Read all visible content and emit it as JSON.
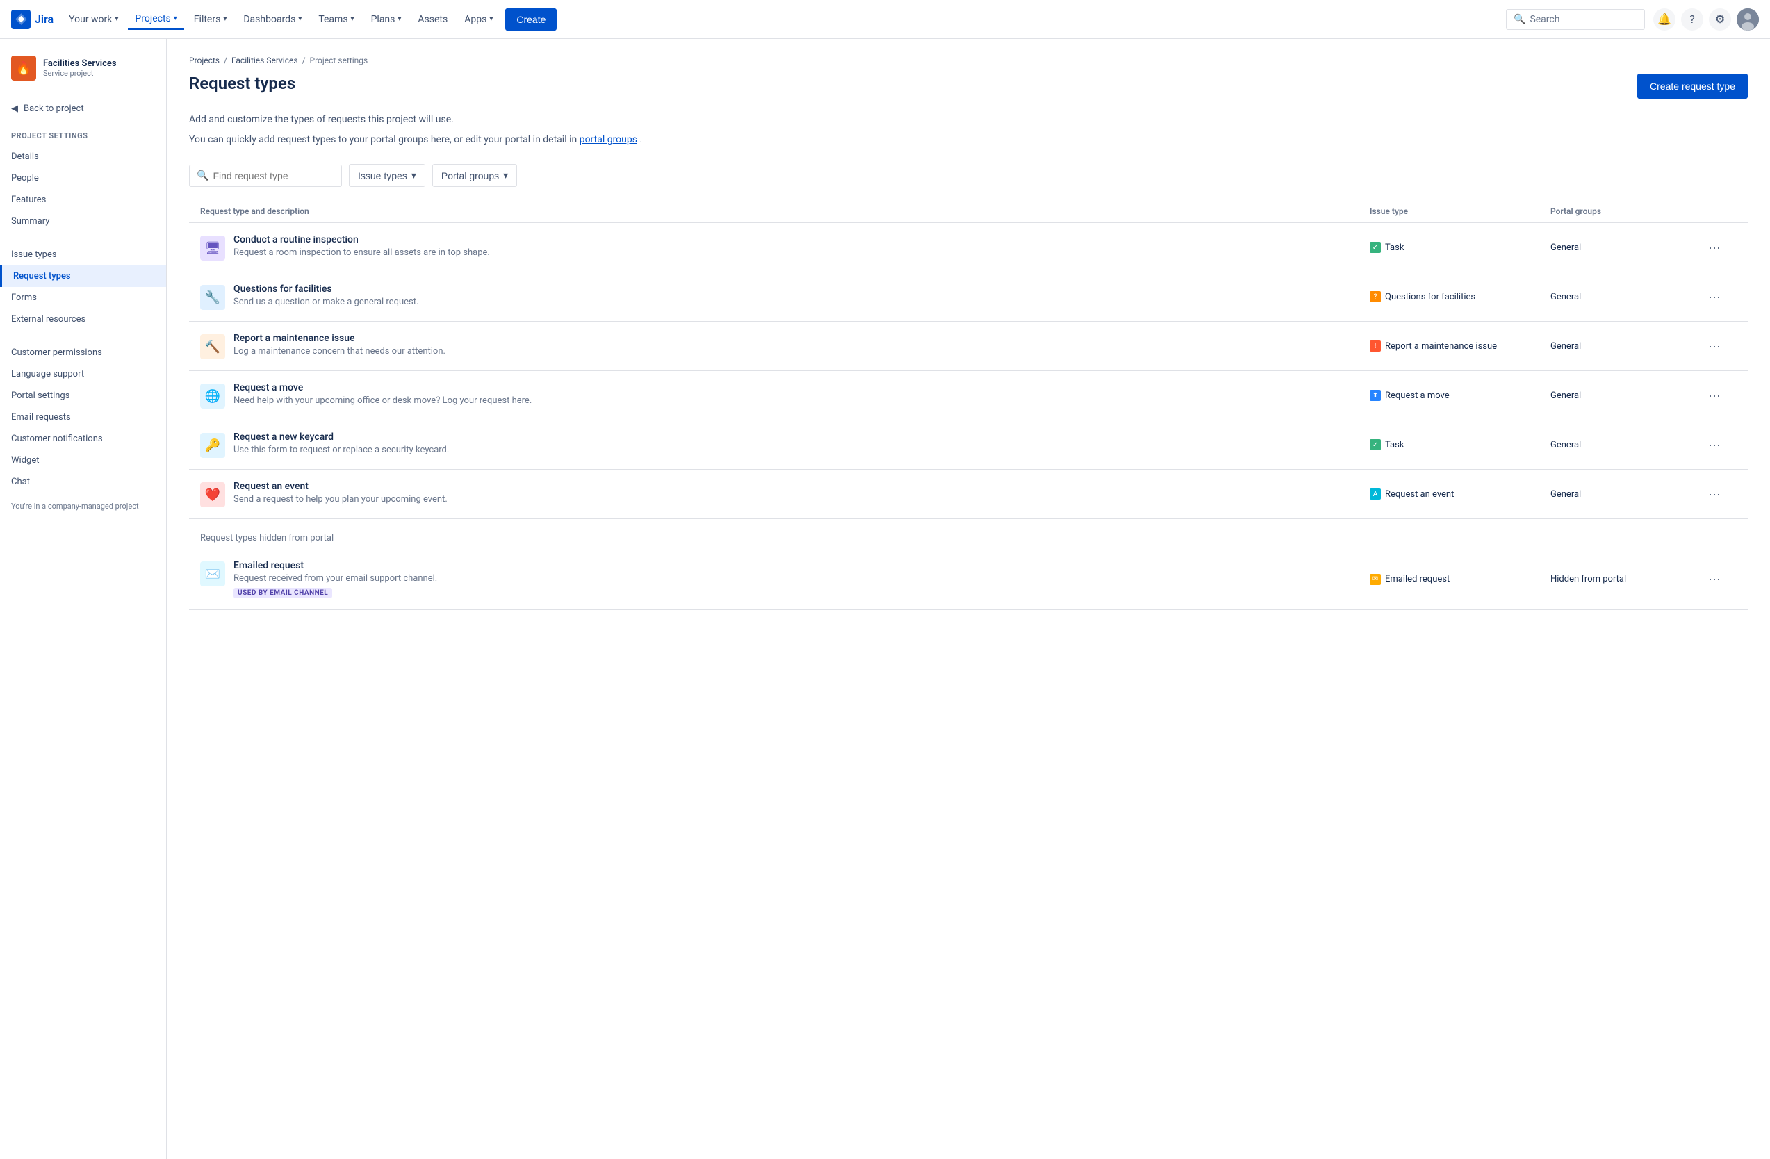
{
  "nav": {
    "logo_text": "Jira",
    "your_work": "Your work",
    "projects": "Projects",
    "filters": "Filters",
    "dashboards": "Dashboards",
    "teams": "Teams",
    "plans": "Plans",
    "assets": "Assets",
    "apps": "Apps",
    "create": "Create",
    "search_placeholder": "Search"
  },
  "sidebar": {
    "project_name": "Facilities Services",
    "project_type": "Service project",
    "back_label": "Back to project",
    "section_title": "Project settings",
    "items": [
      {
        "id": "details",
        "label": "Details"
      },
      {
        "id": "people",
        "label": "People"
      },
      {
        "id": "features",
        "label": "Features"
      },
      {
        "id": "summary",
        "label": "Summary"
      },
      {
        "id": "issue-types",
        "label": "Issue types"
      },
      {
        "id": "request-types",
        "label": "Request types",
        "active": true
      },
      {
        "id": "forms",
        "label": "Forms"
      },
      {
        "id": "external-resources",
        "label": "External resources"
      },
      {
        "id": "customer-permissions",
        "label": "Customer permissions"
      },
      {
        "id": "language-support",
        "label": "Language support"
      },
      {
        "id": "portal-settings",
        "label": "Portal settings"
      },
      {
        "id": "email-requests",
        "label": "Email requests"
      },
      {
        "id": "customer-notifications",
        "label": "Customer notifications"
      },
      {
        "id": "widget",
        "label": "Widget"
      },
      {
        "id": "chat",
        "label": "Chat"
      }
    ],
    "footer": "You're in a company-managed project"
  },
  "breadcrumb": {
    "items": [
      "Projects",
      "Facilities Services",
      "Project settings"
    ]
  },
  "page": {
    "title": "Request types",
    "description_1": "Add and customize the types of requests this project will use.",
    "description_2": "You can quickly add request types to your portal groups here, or edit your portal in detail in",
    "portal_groups_link": "portal groups",
    "description_end": ".",
    "create_button": "Create request type"
  },
  "toolbar": {
    "search_placeholder": "Find request type",
    "issue_types_label": "Issue types",
    "portal_groups_label": "Portal groups"
  },
  "table": {
    "col_request": "Request type and description",
    "col_issue": "Issue type",
    "col_portal": "Portal groups"
  },
  "request_types": [
    {
      "id": 1,
      "icon_bg": "#6554c0",
      "icon_emoji": "🖥️",
      "icon_color": "#6554c0",
      "title": "Conduct a routine inspection",
      "description": "Request a room inspection to ensure all assets are in top shape.",
      "issue_type_icon_bg": "#36b37e",
      "issue_type_icon_color": "#fff",
      "issue_type_icon": "✓",
      "issue_type": "Task",
      "portal_group": "General",
      "hidden": false
    },
    {
      "id": 2,
      "icon_bg": "#fff",
      "icon_emoji": "🔧",
      "icon_color": "#0052cc",
      "title": "Questions for facilities",
      "description": "Send us a question or make a general request.",
      "issue_type_icon_bg": "#ff8b00",
      "issue_type_icon_color": "#fff",
      "issue_type_icon": "?",
      "issue_type": "Questions for facilities",
      "portal_group": "General",
      "hidden": false
    },
    {
      "id": 3,
      "icon_bg": "#fff",
      "icon_emoji": "🔨",
      "icon_color": "#ff5630",
      "title": "Report a maintenance issue",
      "description": "Log a maintenance concern that needs our attention.",
      "issue_type_icon_bg": "#ff5630",
      "issue_type_icon_color": "#fff",
      "issue_type_icon": "!",
      "issue_type": "Report a maintenance issue",
      "portal_group": "General",
      "hidden": false
    },
    {
      "id": 4,
      "icon_bg": "#fff",
      "icon_emoji": "🌐",
      "icon_color": "#0065ff",
      "title": "Request a move",
      "description": "Need help with your upcoming office or desk move? Log your request here.",
      "issue_type_icon_bg": "#2684ff",
      "issue_type_icon_color": "#fff",
      "issue_type_icon": "⬆",
      "issue_type": "Request a move",
      "portal_group": "General",
      "hidden": false
    },
    {
      "id": 5,
      "icon_bg": "#fff",
      "icon_emoji": "🔑",
      "icon_color": "#ff8b00",
      "title": "Request a new keycard",
      "description": "Use this form to request or replace a security keycard.",
      "issue_type_icon_bg": "#36b37e",
      "issue_type_icon_color": "#fff",
      "issue_type_icon": "✓",
      "issue_type": "Task",
      "portal_group": "General",
      "hidden": false
    },
    {
      "id": 6,
      "icon_bg": "#ff5630",
      "icon_emoji": "❤️",
      "icon_color": "#ff5630",
      "title": "Request an event",
      "description": "Send a request to help you plan your upcoming event.",
      "issue_type_icon_bg": "#00b8d9",
      "issue_type_icon_color": "#fff",
      "issue_type_icon": "A",
      "issue_type": "Request an event",
      "portal_group": "General",
      "hidden": false
    }
  ],
  "hidden_section": {
    "label": "Request types hidden from portal",
    "items": [
      {
        "id": 7,
        "icon_bg": "#00b8d9",
        "icon_emoji": "✉️",
        "icon_color": "#00b8d9",
        "title": "Emailed request",
        "description": "Request received from your email support channel.",
        "issue_type_icon_bg": "#ffab00",
        "issue_type_icon_color": "#fff",
        "issue_type_icon": "✉",
        "issue_type": "Emailed request",
        "portal_group": "Hidden from portal",
        "badge": "USED BY EMAIL CHANNEL"
      }
    ]
  }
}
